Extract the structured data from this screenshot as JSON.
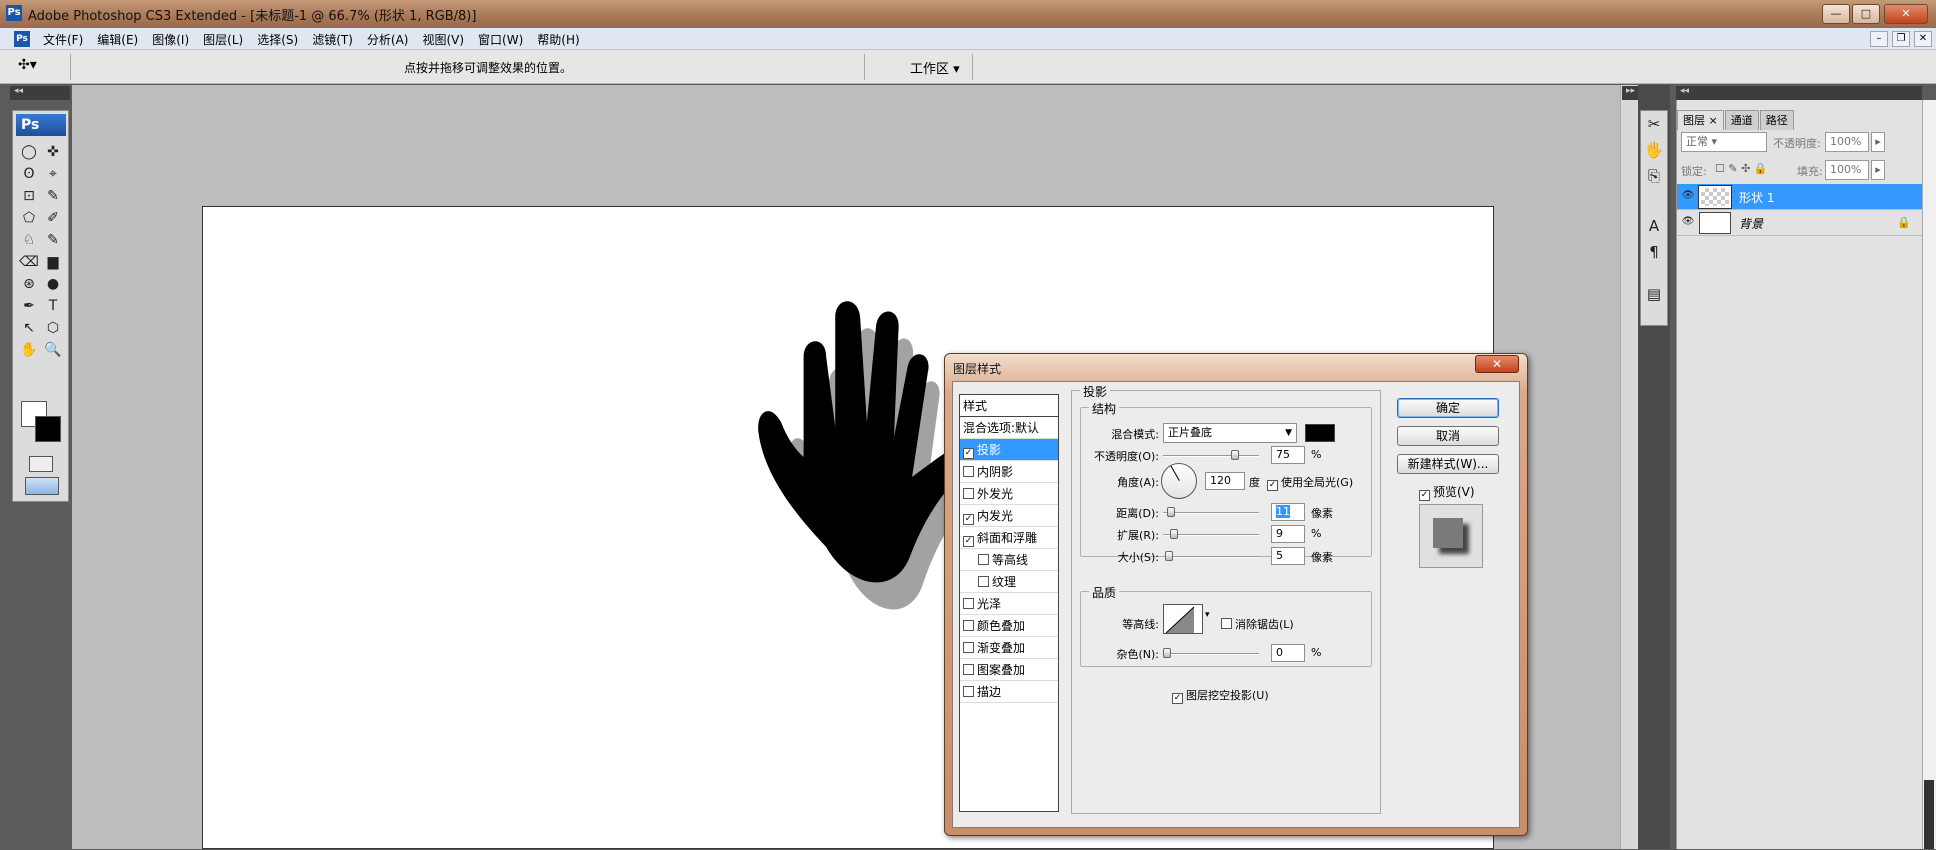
{
  "titlebar": {
    "app_icon": "Ps",
    "title": "Adobe Photoshop CS3 Extended - [未标题-1 @ 66.7% (形状 1, RGB/8)]",
    "minimize": "—",
    "maximize": "□",
    "close": "✕"
  },
  "menubar": {
    "items": [
      "文件(F)",
      "编辑(E)",
      "图像(I)",
      "图层(L)",
      "选择(S)",
      "滤镜(T)",
      "分析(A)",
      "视图(V)",
      "窗口(W)",
      "帮助(H)"
    ],
    "doc_min": "–",
    "doc_restore": "❐",
    "doc_close": "✕"
  },
  "options": {
    "tool_icon": "move-tool-icon",
    "tool_glyph": "✣▾",
    "hint": "点按并拖移可调整效果的位置。",
    "workspace": "工作区 ▾"
  },
  "toolbox": {
    "logo": "Ps",
    "tools": [
      "◯",
      "✜",
      "ʘ",
      "⌖",
      "⊡",
      "✎",
      "⬠",
      "✐",
      "♘",
      "✎",
      "⌫",
      "▆",
      "⊛",
      "●",
      "✒",
      "T",
      "↖",
      "⬡",
      "✋",
      "🔍"
    ],
    "tool_names": [
      "ellipse-marquee-icon",
      "move-icon",
      "lasso-icon",
      "magic-wand-icon",
      "crop-icon",
      "slice-icon",
      "healing-icon",
      "brush-icon",
      "stamp-icon",
      "history-brush-icon",
      "eraser-icon",
      "gradient-icon",
      "blur-icon",
      "dodge-icon",
      "pen-icon",
      "type-icon",
      "path-select-icon",
      "shape-icon",
      "hand-icon",
      "zoom-icon"
    ]
  },
  "minidock": {
    "tools": [
      "✂",
      "🖐",
      "⎘",
      "A",
      "¶",
      "▤"
    ],
    "tool_names": [
      "tool-presets-icon",
      "brushes-icon",
      "clone-source-icon",
      "character-icon",
      "paragraph-icon",
      "navigator-icon"
    ]
  },
  "layers_panel": {
    "tabs": [
      "图层 ×",
      "通道",
      "路径"
    ],
    "blend_mode": "正常",
    "opacity_label": "不透明度:",
    "opacity_value": "100%",
    "lock_label": "锁定:",
    "fill_label": "填充:",
    "fill_value": "100%",
    "layers": [
      {
        "name": "形状 1",
        "active": true
      },
      {
        "name": "背景",
        "active": false,
        "locked": true
      }
    ]
  },
  "dialog": {
    "title": "图层样式",
    "close": "✕",
    "styles_header": "样式",
    "styles": [
      {
        "label": "混合选项:默认",
        "checkbox": false,
        "sub": false,
        "active": false
      },
      {
        "label": "投影",
        "checkbox": true,
        "checked": true,
        "sub": false,
        "active": true
      },
      {
        "label": "内阴影",
        "checkbox": true,
        "checked": false,
        "sub": false,
        "active": false
      },
      {
        "label": "外发光",
        "checkbox": true,
        "checked": false,
        "sub": false,
        "active": false
      },
      {
        "label": "内发光",
        "checkbox": true,
        "checked": true,
        "sub": false,
        "active": false
      },
      {
        "label": "斜面和浮雕",
        "checkbox": true,
        "checked": true,
        "sub": false,
        "active": false
      },
      {
        "label": "等高线",
        "checkbox": true,
        "checked": false,
        "sub": true,
        "active": false
      },
      {
        "label": "纹理",
        "checkbox": true,
        "checked": false,
        "sub": true,
        "active": false
      },
      {
        "label": "光泽",
        "checkbox": true,
        "checked": false,
        "sub": false,
        "active": false
      },
      {
        "label": "颜色叠加",
        "checkbox": true,
        "checked": false,
        "sub": false,
        "active": false
      },
      {
        "label": "渐变叠加",
        "checkbox": true,
        "checked": false,
        "sub": false,
        "active": false
      },
      {
        "label": "图案叠加",
        "checkbox": true,
        "checked": false,
        "sub": false,
        "active": false
      },
      {
        "label": "描边",
        "checkbox": true,
        "checked": false,
        "sub": false,
        "active": false
      }
    ],
    "section_title": "投影",
    "structure_title": "结构",
    "blend_label": "混合模式:",
    "blend_value": "正片叠底",
    "opacity_label": "不透明度(O):",
    "opacity_value": "75",
    "opacity_fraction": 0.75,
    "percent": "%",
    "angle_label": "角度(A):",
    "angle_value": "120",
    "angle_unit": "度",
    "global_light": "使用全局光(G)",
    "distance_label": "距离(D):",
    "distance_value": "11",
    "spread_label": "扩展(R):",
    "spread_value": "9",
    "size_label": "大小(S):",
    "size_value": "5",
    "px_unit": "像素",
    "quality_title": "品质",
    "contour_label": "等高线:",
    "antialias": "消除锯齿(L)",
    "noise_label": "杂色(N):",
    "noise_value": "0",
    "knockout": "图层挖空投影(U)",
    "ok": "确定",
    "cancel": "取消",
    "new_style": "新建样式(W)...",
    "preview": "预览(V)"
  }
}
